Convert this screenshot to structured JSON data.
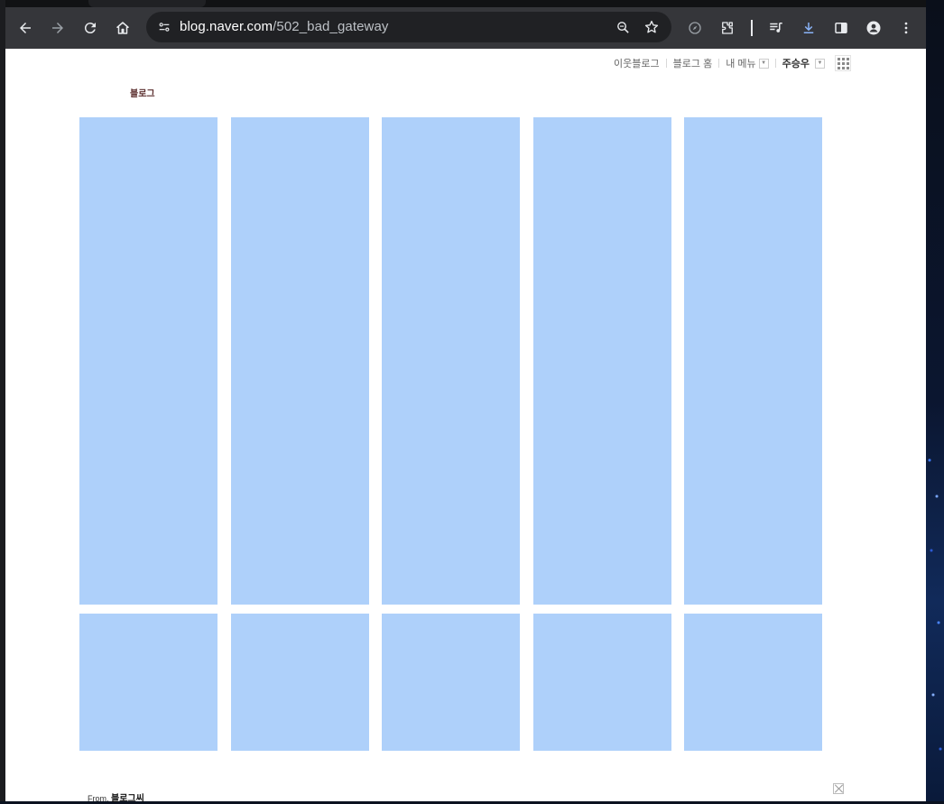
{
  "browser": {
    "url_host": "blog.naver.com",
    "url_path": "/502_bad_gateway",
    "icons": [
      "back-icon",
      "forward-icon",
      "reload-icon",
      "home-icon",
      "site-info-icon",
      "zoom-icon",
      "bookmark-star-icon",
      "compass-icon",
      "extensions-icon",
      "media-icon",
      "download-icon",
      "side-panel-icon",
      "profile-icon",
      "menu-icon"
    ]
  },
  "gnb": {
    "neighbor_blog": "이웃블로그",
    "blog_home": "블로그 홈",
    "my_menu": "내 메뉴",
    "user_name": "주승우"
  },
  "blog": {
    "title": "블로그"
  },
  "tiles": {
    "color": "#aed0fa",
    "rows": 2,
    "columns": 5
  },
  "footer": {
    "from_label": "From.",
    "from_name": "블로그씨"
  }
}
